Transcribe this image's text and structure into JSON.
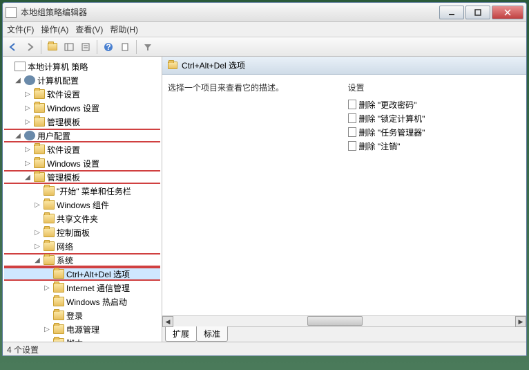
{
  "titlebar": {
    "title": "本地组策略编辑器"
  },
  "menu": {
    "file": "文件(F)",
    "action": "操作(A)",
    "view": "查看(V)",
    "help": "帮助(H)"
  },
  "tree": {
    "root": "本地计算机 策略",
    "computer": {
      "label": "计算机配置",
      "software": "软件设置",
      "windows": "Windows 设置",
      "admin": "管理模板"
    },
    "user": {
      "label": "用户配置",
      "software": "软件设置",
      "windows": "Windows 设置",
      "admin": "管理模板",
      "start": "\"开始\" 菜单和任务栏",
      "components": "Windows 组件",
      "shared": "共享文件夹",
      "controlpanel": "控制面板",
      "network": "网络",
      "system": "系统",
      "ctrlaltdel": "Ctrl+Alt+Del 选项",
      "internet": "Internet 通信管理",
      "hotstart": "Windows 热启动",
      "logon": "登录",
      "power": "电源管理",
      "script": "脚本"
    }
  },
  "right": {
    "header": "Ctrl+Alt+Del 选项",
    "desc": "选择一个项目来查看它的描述。",
    "settings_label": "设置",
    "items": [
      "删除 \"更改密码\"",
      "删除 \"锁定计算机\"",
      "删除 \"任务管理器\"",
      "删除 \"注销\""
    ]
  },
  "tabs": {
    "extended": "扩展",
    "standard": "标准"
  },
  "status": "4 个设置"
}
